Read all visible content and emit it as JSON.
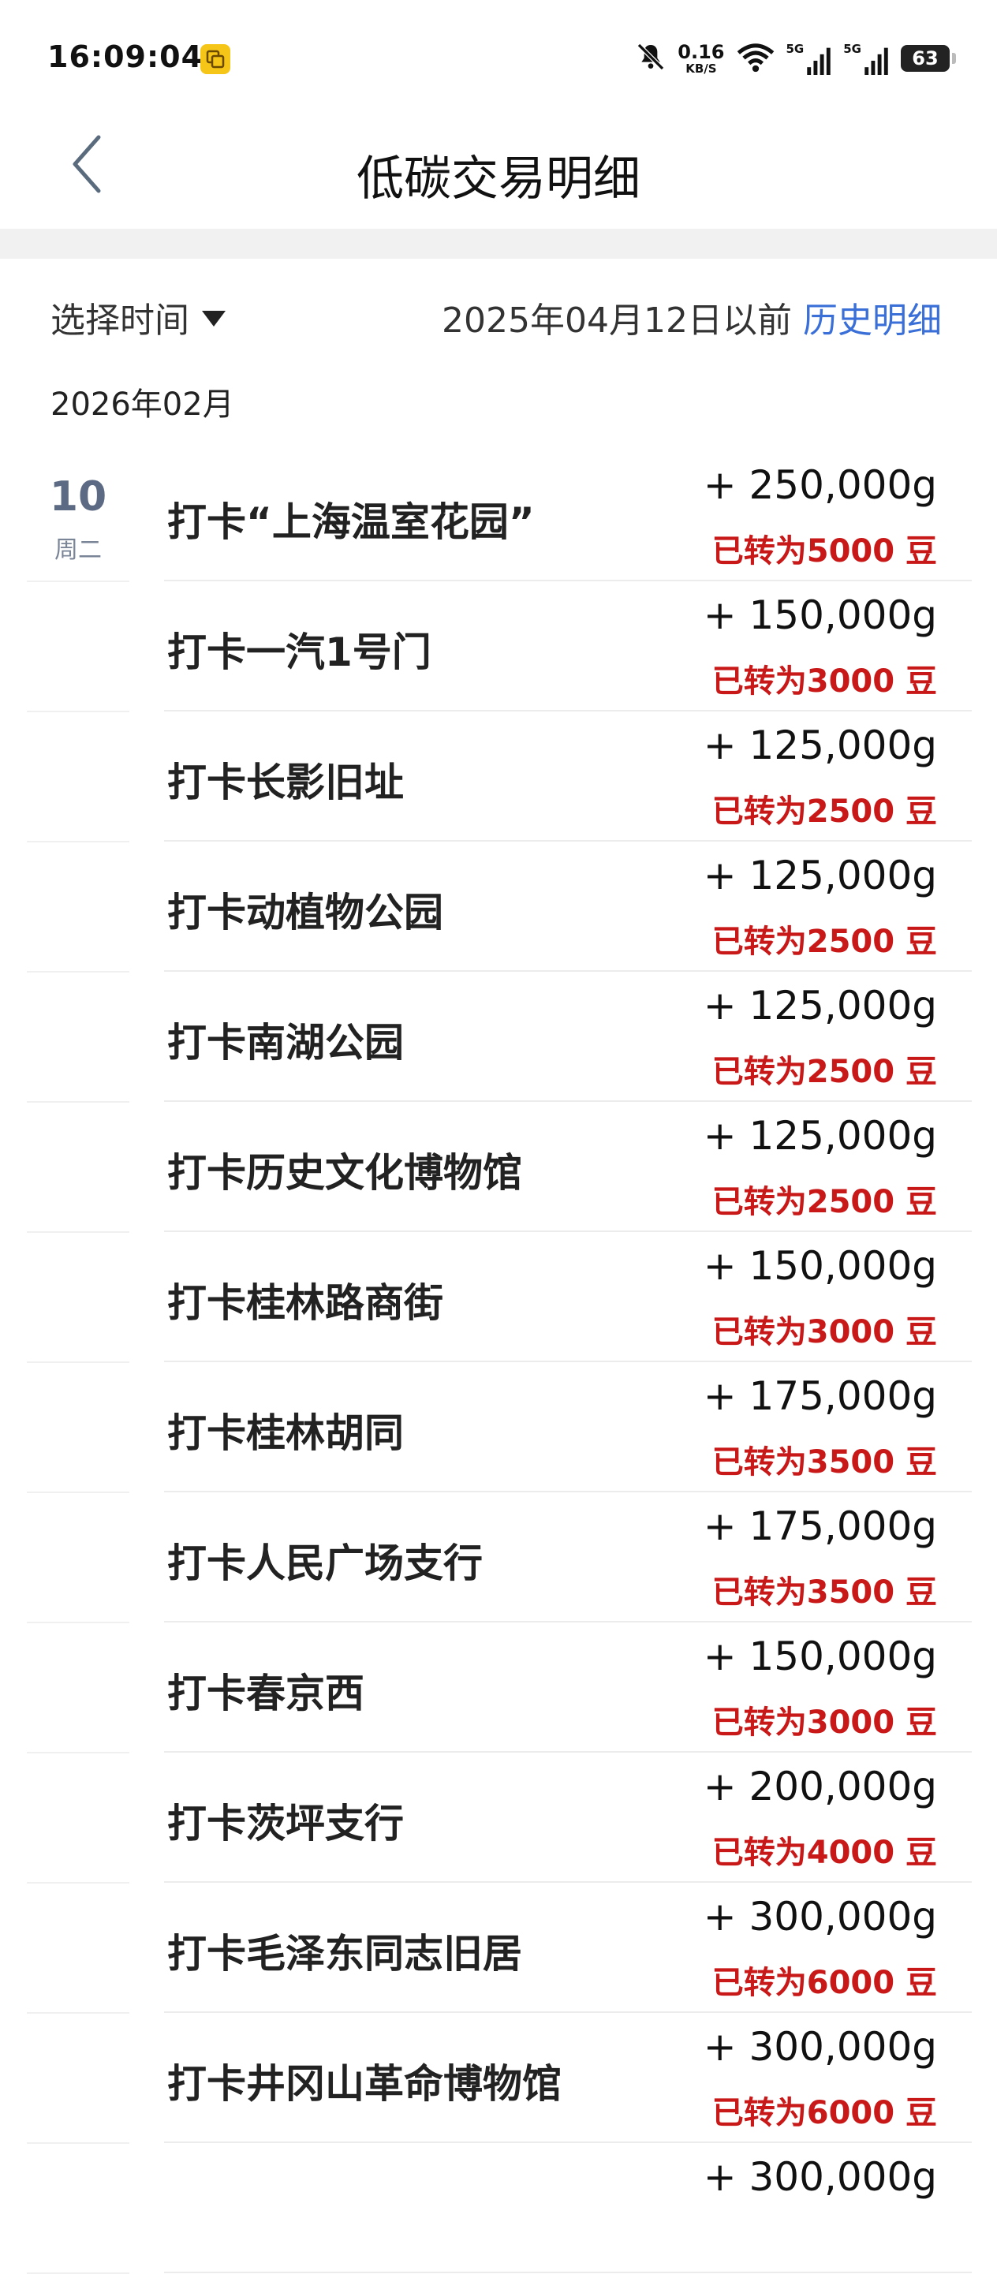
{
  "status_bar": {
    "time": "16:09:04",
    "speed_value": "0.16",
    "speed_unit": "KB/S",
    "net1": "5G",
    "net2": "5G",
    "battery": "63"
  },
  "nav": {
    "title": "低碳交易明细"
  },
  "filter": {
    "select_time_label": "选择时间",
    "history_note": "2025年04月12日以前",
    "history_link": "历史明细"
  },
  "month": "2026年02月",
  "date_group": {
    "day": "10",
    "weekday": "周二"
  },
  "transactions": [
    {
      "title": "打卡“上海温室花园”",
      "amount": "+ 250,000g",
      "converted": "已转为5000 豆"
    },
    {
      "title": "打卡一汽1号门",
      "amount": "+ 150,000g",
      "converted": "已转为3000 豆"
    },
    {
      "title": "打卡长影旧址",
      "amount": "+ 125,000g",
      "converted": "已转为2500 豆"
    },
    {
      "title": "打卡动植物公园",
      "amount": "+ 125,000g",
      "converted": "已转为2500 豆"
    },
    {
      "title": "打卡南湖公园",
      "amount": "+ 125,000g",
      "converted": "已转为2500 豆"
    },
    {
      "title": "打卡历史文化博物馆",
      "amount": "+ 125,000g",
      "converted": "已转为2500 豆"
    },
    {
      "title": "打卡桂林路商街",
      "amount": "+ 150,000g",
      "converted": "已转为3000 豆"
    },
    {
      "title": "打卡桂林胡同",
      "amount": "+ 175,000g",
      "converted": "已转为3500 豆"
    },
    {
      "title": "打卡人民广场支行",
      "amount": "+ 175,000g",
      "converted": "已转为3500 豆"
    },
    {
      "title": "打卡春京西",
      "amount": "+ 150,000g",
      "converted": "已转为3000 豆"
    },
    {
      "title": "打卡茨坪支行",
      "amount": "+ 200,000g",
      "converted": "已转为4000 豆"
    },
    {
      "title": "打卡毛泽东同志旧居",
      "amount": "+ 300,000g",
      "converted": "已转为6000 豆"
    },
    {
      "title": "打卡井冈山革命博物馆",
      "amount": "+ 300,000g",
      "converted": "已转为6000 豆"
    },
    {
      "title": "",
      "amount": "+ 300,000g",
      "converted": ""
    }
  ],
  "icons": {
    "back": "chevron-left-icon",
    "dropdown": "caret-down-icon",
    "mute": "bell-off-icon",
    "wifi": "wifi-icon",
    "signal": "signal-icon",
    "app": "copy-icon"
  },
  "colors": {
    "accent_link": "#3a6fd8",
    "converted_red": "#c81818",
    "date_blue_gray": "#5c6a83"
  }
}
